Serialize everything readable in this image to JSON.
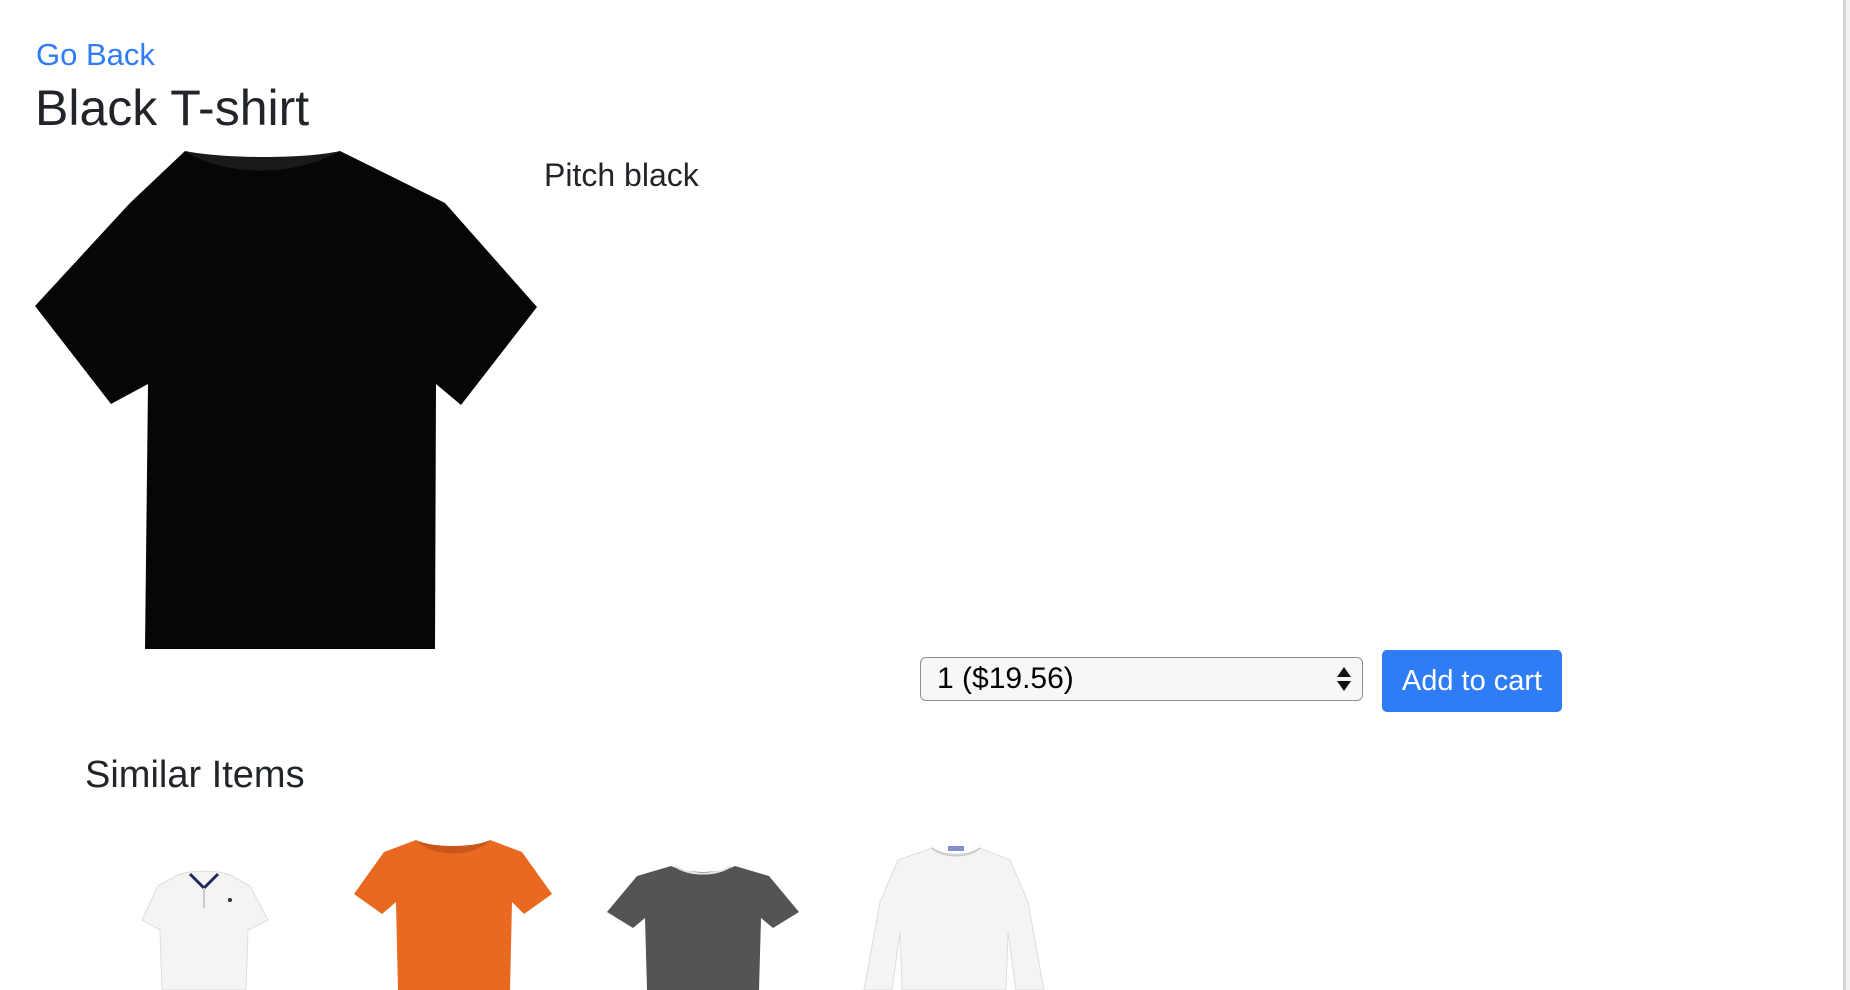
{
  "nav": {
    "go_back_label": "Go Back"
  },
  "product": {
    "title": "Black T-shirt",
    "description": "Pitch black",
    "image_icon": "black-tshirt-image"
  },
  "purchase": {
    "quantity_selected": "1 ($19.56)",
    "add_to_cart_label": "Add to cart"
  },
  "similar": {
    "heading": "Similar Items",
    "items": [
      {
        "icon": "white-polo-shirt-image"
      },
      {
        "icon": "orange-tshirt-image"
      },
      {
        "icon": "gray-tshirt-image"
      },
      {
        "icon": "white-long-sleeve-shirt-image"
      }
    ]
  },
  "colors": {
    "link": "#2e7cf6",
    "button": "#2e7cf6",
    "text": "#212529",
    "orange": "#e8691f",
    "gray": "#545454",
    "white_shirt": "#f4f4f4"
  }
}
